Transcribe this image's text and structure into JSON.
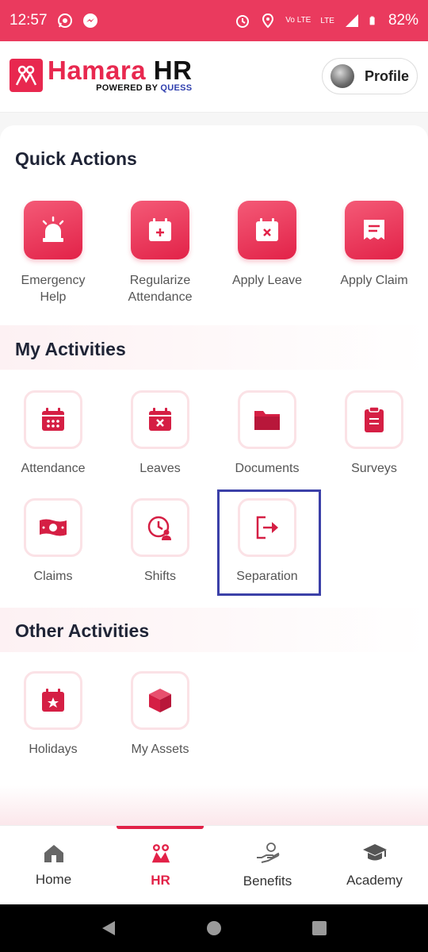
{
  "status_bar": {
    "time": "12:57",
    "network": "Vo LTE",
    "lte": "LTE",
    "battery": "82%",
    "icons": [
      "whatsapp-icon",
      "messenger-icon",
      "alarm-icon",
      "location-icon",
      "signal-icon",
      "battery-icon"
    ]
  },
  "header": {
    "logo_main_a": "Hamara",
    "logo_main_b": "HR",
    "logo_sub_a": "POWERED BY",
    "logo_sub_b": "QUESS",
    "profile_label": "Profile"
  },
  "quick_actions": {
    "title": "Quick Actions",
    "items": [
      {
        "label": "Emergency\nHelp",
        "icon": "siren-icon"
      },
      {
        "label": "Regularize\nAttendance",
        "icon": "calendar-plus-icon"
      },
      {
        "label": "Apply Leave",
        "icon": "calendar-x-icon"
      },
      {
        "label": "Apply Claim",
        "icon": "receipt-icon"
      }
    ]
  },
  "my_activities": {
    "title": "My Activities",
    "items": [
      {
        "label": "Attendance",
        "icon": "calendar-icon"
      },
      {
        "label": "Leaves",
        "icon": "calendar-x-icon"
      },
      {
        "label": "Documents",
        "icon": "folder-icon"
      },
      {
        "label": "Surveys",
        "icon": "clipboard-icon"
      },
      {
        "label": "Claims",
        "icon": "banknote-icon"
      },
      {
        "label": "Shifts",
        "icon": "clock-user-icon"
      },
      {
        "label": "Separation",
        "icon": "exit-icon"
      }
    ]
  },
  "other_activities": {
    "title": "Other Activities",
    "items": [
      {
        "label": "Holidays",
        "icon": "calendar-star-icon"
      },
      {
        "label": "My Assets",
        "icon": "box-icon"
      }
    ]
  },
  "bottom_nav": {
    "items": [
      {
        "label": "Home",
        "icon": "home-icon"
      },
      {
        "label": "HR",
        "icon": "people-icon",
        "active": true
      },
      {
        "label": "Benefits",
        "icon": "hand-coin-icon"
      },
      {
        "label": "Academy",
        "icon": "graduation-cap-icon"
      }
    ]
  },
  "colors": {
    "accent": "#e22248",
    "status_bar": "#ea3a5e",
    "highlight_box": "#3b40a8"
  }
}
